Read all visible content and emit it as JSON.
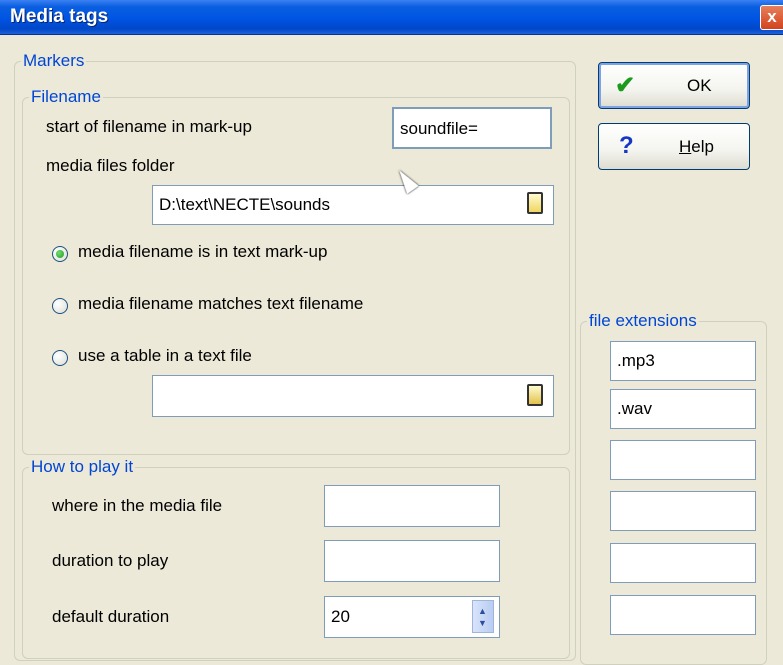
{
  "window": {
    "title": "Media tags",
    "close_glyph": "x"
  },
  "buttons": {
    "ok": {
      "label": "OK",
      "icon": "checkmark-icon",
      "icon_glyph": "✔",
      "icon_color": "#1b9a1b"
    },
    "help": {
      "label_underlined": "H",
      "label_rest": "elp",
      "icon": "question-mark-icon",
      "icon_glyph": "?",
      "icon_color": "#1636c8"
    }
  },
  "markers": {
    "legend": "Markers",
    "filename": {
      "legend": "Filename",
      "start_label": "start of filename in mark-up",
      "start_value": "soundfile=",
      "folder_label": "media files folder",
      "folder_value": "D:\\text\\NECTE\\sounds",
      "options": [
        {
          "label": "media filename is in text mark-up",
          "selected": true
        },
        {
          "label": "media filename matches text filename",
          "selected": false
        },
        {
          "label": "use a table in a text file",
          "selected": false
        }
      ],
      "table_file_value": ""
    }
  },
  "how_to_play": {
    "legend": "How to play it",
    "where_label": "where in the media file",
    "where_value": "",
    "duration_label": "duration to play",
    "duration_value": "",
    "default_label": "default duration",
    "default_value": "20"
  },
  "file_extensions": {
    "legend": "file extensions",
    "values": [
      ".mp3",
      ".wav",
      "",
      "",
      "",
      ""
    ]
  }
}
